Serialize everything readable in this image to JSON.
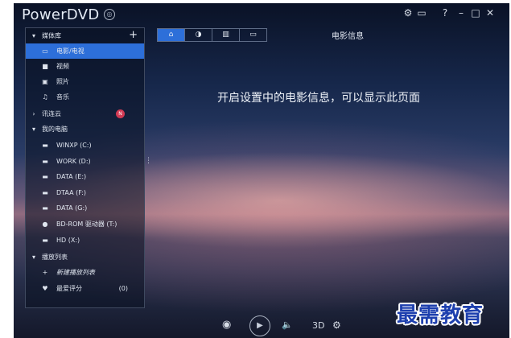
{
  "app": {
    "name": "PowerDVD",
    "logo_glyph": "◎"
  },
  "titlebar": {
    "settings_icon": "⚙",
    "tv_icon": "▭",
    "help": "?",
    "minimize": "–",
    "maximize": "□",
    "close": "✕"
  },
  "sidebar": {
    "add_glyph": "+",
    "badge_glyph": "N",
    "favorites_count": "(0)",
    "items": [
      {
        "label": "媒体库",
        "glyph": "▾"
      },
      {
        "label": "电影/电视",
        "glyph": "▭"
      },
      {
        "label": "视频",
        "glyph": "■"
      },
      {
        "label": "照片",
        "glyph": "▣"
      },
      {
        "label": "音乐",
        "glyph": "♫"
      },
      {
        "label": "讯连云",
        "glyph": "›"
      },
      {
        "label": "我的电脑",
        "glyph": "▾"
      },
      {
        "label": "WINXP (C:)",
        "glyph": "▬"
      },
      {
        "label": "WORK (D:)",
        "glyph": "▬"
      },
      {
        "label": "DATA (E:)",
        "glyph": "▬"
      },
      {
        "label": "DTAA (F:)",
        "glyph": "▬"
      },
      {
        "label": "DATA (G:)",
        "glyph": "▬"
      },
      {
        "label": "BD-ROM 驱动器 (T:)",
        "glyph": "●"
      },
      {
        "label": "HD (X:)",
        "glyph": "▬"
      },
      {
        "label": "播放列表",
        "glyph": "▾"
      },
      {
        "label": "新建播放列表",
        "glyph": "+"
      },
      {
        "label": "最爱评分",
        "glyph": "♥"
      }
    ]
  },
  "dots": "⋮",
  "view_tabs": [
    {
      "glyph": "⌂"
    },
    {
      "glyph": "◑"
    },
    {
      "glyph": "▥"
    },
    {
      "glyph": "▭"
    }
  ],
  "page_title": "电影信息",
  "message": "开启设置中的电影信息，可以显示此页面",
  "controls": {
    "eye": "◉",
    "play": "▶",
    "volume": "🔈",
    "three_d": "3D",
    "settings": "⚙"
  },
  "watermark": "最需教育",
  "colors": {
    "accent": "#2d6fd9",
    "badge": "#d23a54",
    "watermark": "#1d3fae"
  }
}
